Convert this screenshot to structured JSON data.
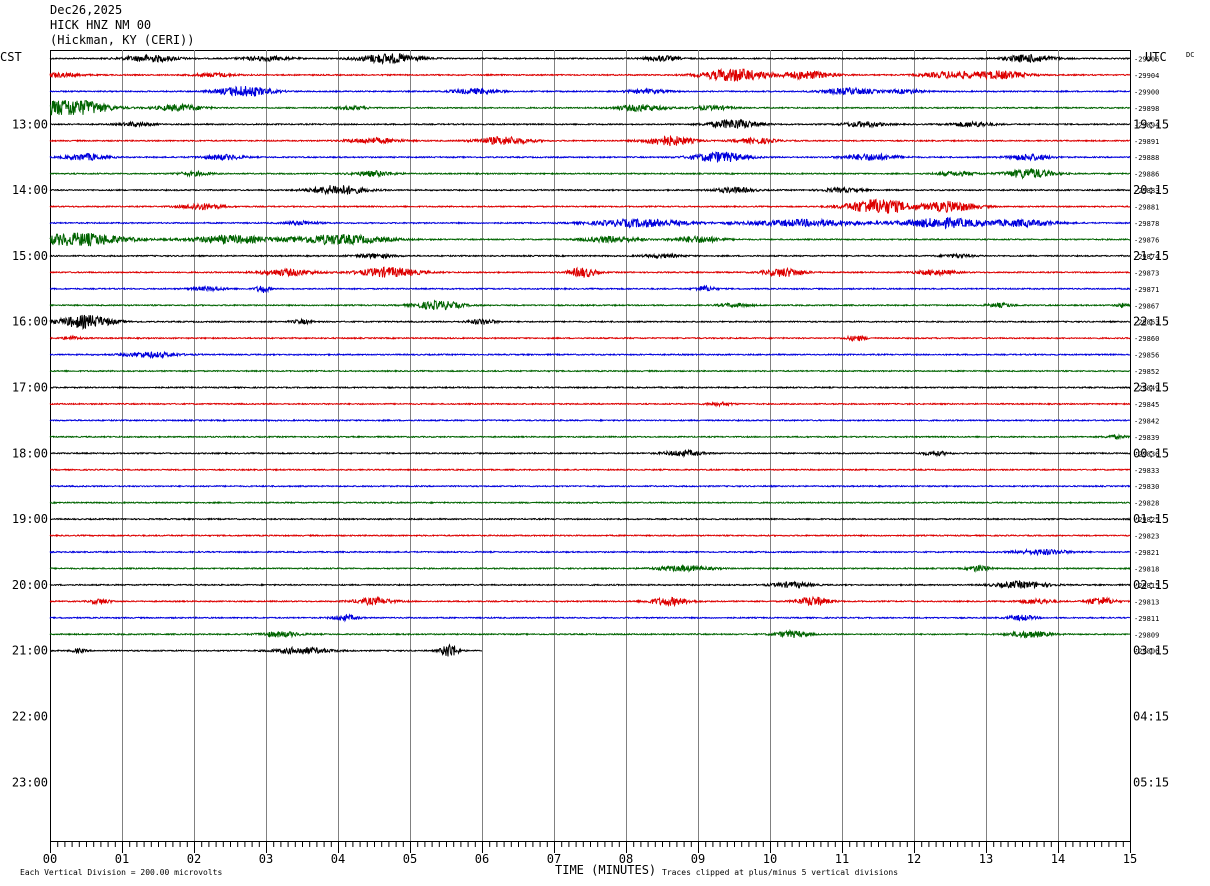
{
  "header": {
    "date": "Dec26,2025",
    "station": "HICK HNZ NM 00",
    "location": "(Hickman, KY (CERI))"
  },
  "labels": {
    "left_tz": "CST",
    "right_tz": "UTC",
    "dc": "DC",
    "x_title": "TIME (MINUTES)",
    "footer_left": "Each Vertical Division =  200.00 microvolts",
    "footer_right": "Traces clipped at plus/minus 5 vertical divisions"
  },
  "colors": {
    "trace_cycle": [
      "#000000",
      "#dd0000",
      "#0000dd",
      "#006400"
    ],
    "grid": "#808080"
  },
  "chart_data": {
    "type": "line",
    "title": "HICK HNZ NM 00",
    "xlabel": "TIME (MINUTES)",
    "x_ticks": [
      "00",
      "01",
      "02",
      "03",
      "04",
      "05",
      "06",
      "07",
      "08",
      "09",
      "10",
      "11",
      "12",
      "13",
      "14",
      "15"
    ],
    "xlim": [
      0,
      15
    ],
    "left_hour_labels": [
      "13:00",
      "14:00",
      "15:00",
      "16:00",
      "17:00",
      "18:00",
      "19:00",
      "20:00",
      "21:00",
      "22:00",
      "23:00"
    ],
    "right_hour_labels": [
      "19:15",
      "20:15",
      "21:15",
      "22:15",
      "23:15",
      "00:15",
      "01:15",
      "02:15",
      "03:15",
      "04:15",
      "05:15"
    ],
    "trace_offsets": [
      -29906,
      -29904,
      -29900,
      -29898,
      -29894,
      -29891,
      -29888,
      -29886,
      -29883,
      -29881,
      -29878,
      -29876,
      -29874,
      -29873,
      -29871,
      -29867,
      -29863,
      -29860,
      -29856,
      -29852,
      -29849,
      -29845,
      -29842,
      -29839,
      -29836,
      -29833,
      -29830,
      -29828,
      -29825,
      -29823,
      -29821,
      -29818,
      -29815,
      -29813,
      -29811,
      -29809,
      -29806
    ],
    "last_trace_end_minute": 6,
    "events": [
      [
        [
          1.4,
          0.8,
          1
        ],
        [
          3,
          0.7,
          0.7
        ],
        [
          4.7,
          0.9,
          1.5
        ],
        [
          8.5,
          0.5,
          0.8
        ],
        [
          13.6,
          0.7,
          1.2
        ]
      ],
      [
        [
          0.1,
          0.7,
          0.6
        ],
        [
          2.3,
          0.6,
          0.6
        ],
        [
          9.5,
          0.9,
          2
        ],
        [
          10.5,
          0.8,
          1.2
        ],
        [
          12.5,
          0.8,
          1
        ],
        [
          13.2,
          0.8,
          1.2
        ]
      ],
      [
        [
          2.7,
          0.8,
          1.6
        ],
        [
          5.9,
          0.7,
          0.8
        ],
        [
          8.3,
          0.6,
          0.6
        ],
        [
          11.1,
          0.8,
          1
        ],
        [
          11.9,
          0.5,
          0.6
        ]
      ],
      [
        [
          0.3,
          1.0,
          3
        ],
        [
          1.8,
          0.7,
          1
        ],
        [
          4.2,
          0.5,
          0.5
        ],
        [
          8.2,
          0.7,
          1
        ],
        [
          9.2,
          0.6,
          0.6
        ]
      ],
      [
        [
          1.2,
          0.5,
          0.6
        ],
        [
          9.5,
          0.7,
          1.5
        ],
        [
          11.3,
          0.6,
          0.8
        ],
        [
          12.8,
          0.6,
          0.8
        ]
      ],
      [
        [
          4.5,
          0.8,
          0.8
        ],
        [
          6.3,
          0.8,
          1.2
        ],
        [
          8.6,
          0.7,
          1.5
        ],
        [
          9.8,
          0.6,
          0.8
        ]
      ],
      [
        [
          0.5,
          0.6,
          1
        ],
        [
          2.4,
          0.6,
          0.8
        ],
        [
          9.3,
          0.8,
          1.6
        ],
        [
          11.4,
          0.8,
          1
        ],
        [
          13.6,
          0.6,
          1
        ]
      ],
      [
        [
          2.0,
          0.5,
          0.6
        ],
        [
          4.5,
          0.6,
          0.8
        ],
        [
          12.6,
          0.6,
          0.6
        ],
        [
          13.6,
          0.7,
          1.5
        ]
      ],
      [
        [
          4.0,
          0.8,
          1.5
        ],
        [
          9.5,
          0.6,
          0.8
        ],
        [
          11.0,
          0.6,
          0.6
        ]
      ],
      [
        [
          2.1,
          0.6,
          1
        ],
        [
          11.5,
          0.9,
          2.5
        ],
        [
          12.5,
          0.8,
          1.6
        ]
      ],
      [
        [
          3.5,
          0.5,
          0.6
        ],
        [
          8.2,
          1.4,
          1.2
        ],
        [
          10.5,
          1.8,
          1
        ],
        [
          12.4,
          1.2,
          1.5
        ],
        [
          13.5,
          1.0,
          1
        ]
      ],
      [
        [
          0.4,
          1.4,
          2
        ],
        [
          2.5,
          1.2,
          1.2
        ],
        [
          4.0,
          1.4,
          1.5
        ],
        [
          7.8,
          0.8,
          1
        ],
        [
          9.0,
          0.7,
          1
        ]
      ],
      [
        [
          4.5,
          0.6,
          0.6
        ],
        [
          8.5,
          0.6,
          0.5
        ],
        [
          12.6,
          0.5,
          0.5
        ]
      ],
      [
        [
          3.3,
          0.8,
          1
        ],
        [
          4.7,
          0.9,
          1.5
        ],
        [
          7.4,
          0.4,
          1.5
        ],
        [
          10.2,
          0.6,
          1.3
        ],
        [
          12.3,
          0.6,
          0.8
        ]
      ],
      [
        [
          2.2,
          0.5,
          0.6
        ],
        [
          2.95,
          0.2,
          1.2
        ],
        [
          9.1,
          0.3,
          0.8
        ]
      ],
      [
        [
          5.4,
          0.7,
          1.3
        ],
        [
          9.5,
          0.5,
          0.5
        ],
        [
          13.2,
          0.4,
          0.6
        ],
        [
          14.9,
          0.2,
          0.6
        ]
      ],
      [
        [
          0.5,
          0.8,
          2
        ],
        [
          3.5,
          0.3,
          0.6
        ],
        [
          6.0,
          0.4,
          0.8
        ]
      ],
      [
        [
          0.3,
          0.3,
          0.5
        ],
        [
          11.2,
          0.3,
          0.8
        ]
      ],
      [
        [
          1.4,
          0.8,
          0.8
        ]
      ],
      [],
      [],
      [
        [
          9.3,
          0.4,
          0.5
        ]
      ],
      [],
      [
        [
          14.8,
          0.3,
          0.5
        ]
      ],
      [
        [
          8.8,
          0.6,
          0.8
        ],
        [
          12.3,
          0.4,
          0.6
        ]
      ],
      [],
      [],
      [],
      [],
      [],
      [
        [
          13.8,
          0.8,
          0.8
        ]
      ],
      [
        [
          8.8,
          0.8,
          0.8
        ],
        [
          12.9,
          0.3,
          1
        ]
      ],
      [
        [
          10.3,
          0.6,
          0.8
        ],
        [
          13.5,
          0.8,
          1
        ]
      ],
      [
        [
          0.7,
          0.3,
          0.8
        ],
        [
          4.5,
          0.6,
          1
        ],
        [
          8.6,
          0.6,
          1.2
        ],
        [
          10.6,
          0.5,
          1.4
        ],
        [
          13.7,
          0.5,
          0.8
        ],
        [
          14.6,
          0.4,
          1.2
        ]
      ],
      [
        [
          4.1,
          0.4,
          0.8
        ],
        [
          13.5,
          0.4,
          0.8
        ]
      ],
      [
        [
          3.2,
          0.6,
          0.8
        ],
        [
          10.3,
          0.5,
          1
        ],
        [
          13.6,
          0.6,
          1
        ]
      ],
      [
        [
          0.4,
          0.2,
          0.6
        ],
        [
          3.5,
          0.8,
          1
        ],
        [
          5.55,
          0.25,
          2.2
        ]
      ]
    ]
  }
}
